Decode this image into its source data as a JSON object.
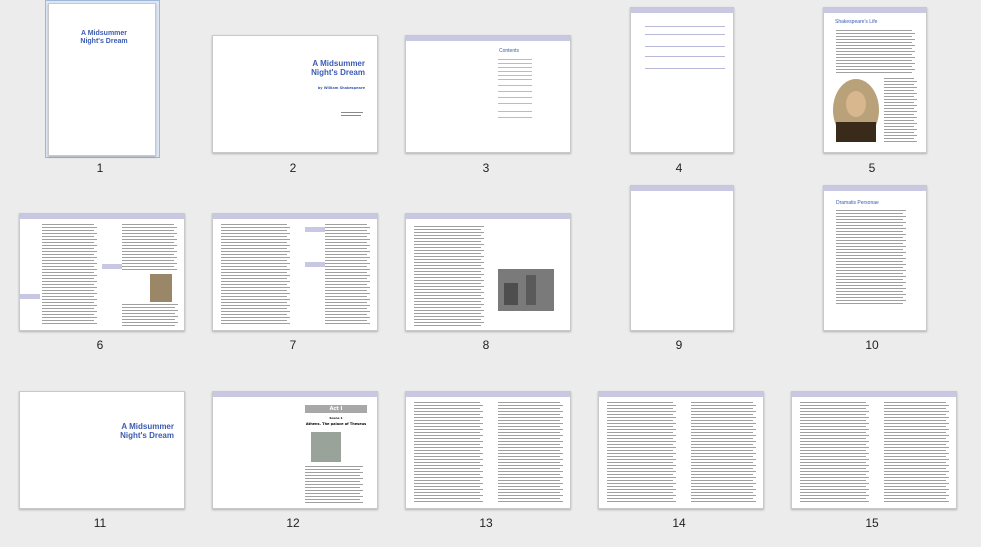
{
  "pages": [
    {
      "number": "1",
      "title": "A Midsummer Night's Dream"
    },
    {
      "number": "2",
      "title": "A Midsummer Night's Dream",
      "byline": "by William Shakespeare"
    },
    {
      "number": "3",
      "heading": "Contents"
    },
    {
      "number": "4"
    },
    {
      "number": "5",
      "heading": "Shakespeare's Life"
    },
    {
      "number": "6"
    },
    {
      "number": "7"
    },
    {
      "number": "8"
    },
    {
      "number": "9"
    },
    {
      "number": "10",
      "heading": "Dramatis Personae"
    },
    {
      "number": "11",
      "title": "A Midsummer Night's Dream"
    },
    {
      "number": "12",
      "act": "Act I",
      "scene": "Scene 1",
      "place": "Athens. The palace of Theseus"
    },
    {
      "number": "13"
    },
    {
      "number": "14"
    },
    {
      "number": "15"
    }
  ],
  "colors": {
    "accent": "#3b5bb3",
    "header_band": "#c9c8e3",
    "selection": "#dfe8f5"
  }
}
